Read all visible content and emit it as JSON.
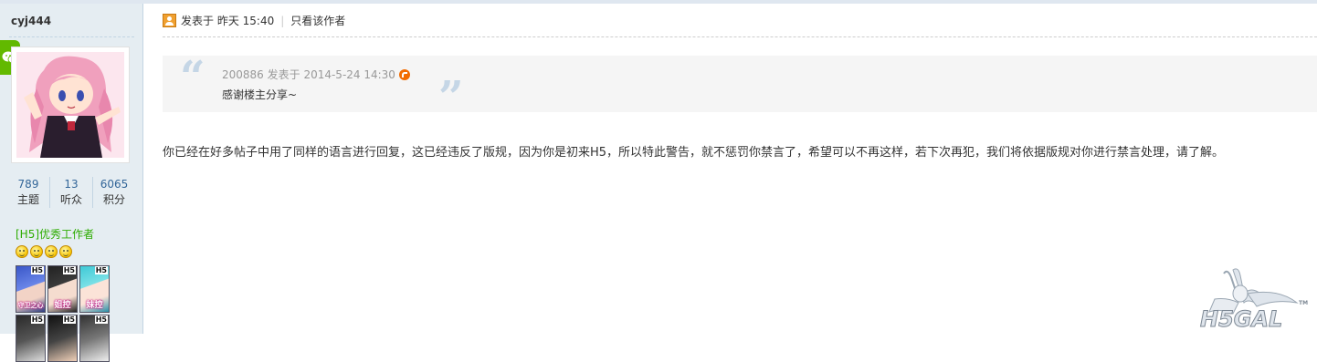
{
  "sidebar": {
    "username": "cyj444",
    "stats": [
      {
        "value": "789",
        "label": "主题"
      },
      {
        "value": "13",
        "label": "听众"
      },
      {
        "value": "6065",
        "label": "积分"
      }
    ],
    "group": "[H5]优秀工作者",
    "medal_count": 4,
    "badges": [
      {
        "tag": "H5",
        "caption": "守卫之心"
      },
      {
        "tag": "H5",
        "caption": "姐控"
      },
      {
        "tag": "H5",
        "caption": "妹控"
      },
      {
        "tag": "H5",
        "caption": ""
      },
      {
        "tag": "H5",
        "caption": ""
      },
      {
        "tag": "H5",
        "caption": ""
      }
    ]
  },
  "post": {
    "posted_label": "发表于",
    "posted_time": "昨天 15:40",
    "author_only": "只看该作者",
    "quote": {
      "meta": "200886 发表于 2014-5-24 14:30",
      "text": "感谢楼主分享~"
    },
    "body": "你已经在好多帖子中用了同样的语言进行回复，这已经违反了版规，因为你是初来H5，所以特此警告，就不惩罚你禁言了，希望可以不再这样，若下次再犯，我们将依据版规对你进行禁言处理，请了解。"
  },
  "icons": {
    "wechat": "wechat-icon",
    "post": "post-author-icon",
    "jump": "jump-to-post-icon",
    "quote_open": "quote-open-icon",
    "quote_close": "quote-close-icon"
  },
  "colors": {
    "sidebar_bg": "#e5edf2",
    "group_green": "#2dac00",
    "link_blue": "#336699",
    "quote_bg": "#f5f5f5",
    "accent_orange": "#f26c00"
  }
}
